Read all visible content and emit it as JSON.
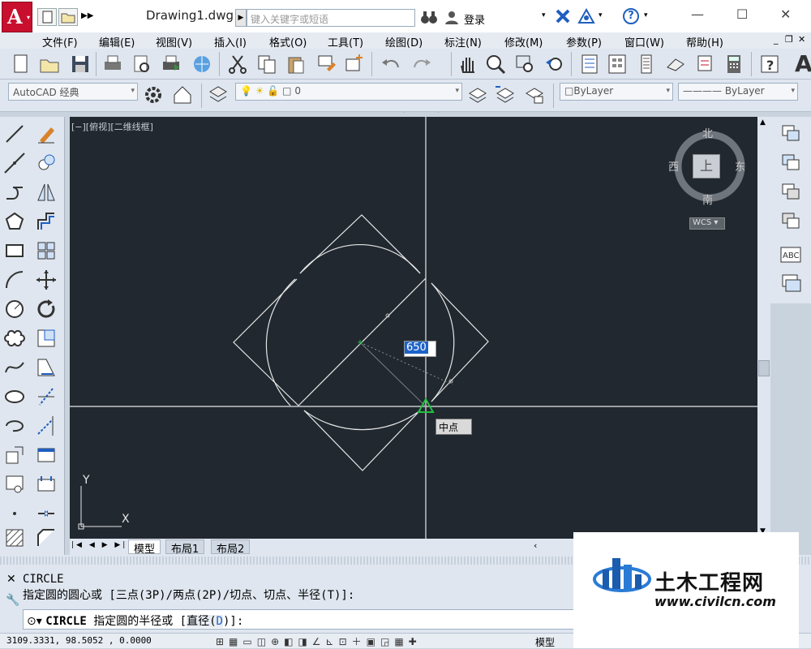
{
  "titlebar": {
    "document_title": "Drawing1.dwg",
    "search_placeholder": "键入关键字或短语",
    "login_label": "登录"
  },
  "menu": [
    "文件(F)",
    "编辑(E)",
    "视图(V)",
    "插入(I)",
    "格式(O)",
    "工具(T)",
    "绘图(D)",
    "标注(N)",
    "修改(M)",
    "参数(P)",
    "窗口(W)",
    "帮助(H)"
  ],
  "toolbar2": {
    "workspace": "AutoCAD 经典",
    "layer": "0",
    "color": "ByLayer",
    "linetype": "ByLayer"
  },
  "viewport": {
    "label": "[−][俯视][二维线框]",
    "viewcube": {
      "north": "北",
      "south": "南",
      "east": "东",
      "west": "西",
      "top": "上",
      "wcs": "WCS"
    },
    "ucs_x": "X",
    "ucs_y": "Y",
    "dynamic_input": "650",
    "snap_tooltip": "中点"
  },
  "tabs": [
    "模型",
    "布局1",
    "布局2"
  ],
  "command": {
    "history": [
      "CIRCLE",
      "指定圆的圆心或 [三点(3P)/两点(2P)/切点、切点、半径(T)]:"
    ],
    "prompt_cmd": "CIRCLE",
    "prompt_text": "指定圆的半径或 [",
    "prompt_option": "直径(",
    "prompt_key": "D",
    "prompt_end": ")]:"
  },
  "status": {
    "coordinates": "3109.3331, 98.5052  , 0.0000",
    "model_label": "模型"
  },
  "watermark": {
    "brand": "土木工程网",
    "url": "www.civilcn.com"
  },
  "colors": {
    "canvas": "#212830",
    "geometry": "#e6e6e6",
    "snap_marker": "#22c040",
    "accent_red": "#c8102e"
  }
}
